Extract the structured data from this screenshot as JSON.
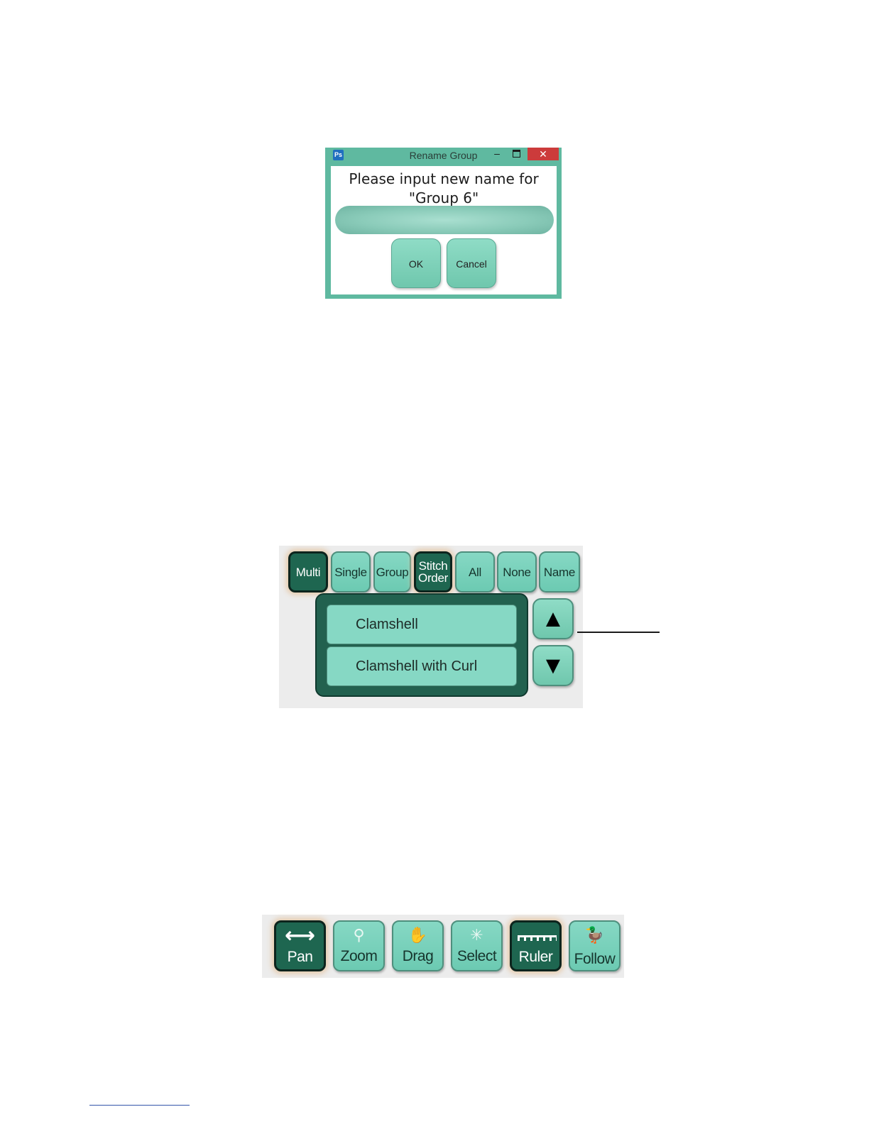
{
  "rename_dialog": {
    "title": "Rename Group",
    "app_icon": "Ps",
    "minimize_glyph": "–",
    "close_glyph": "✕",
    "prompt_line1": "Please input new name for",
    "prompt_line2": "\"Group 6\"",
    "input_value": "",
    "ok_label": "OK",
    "cancel_label": "Cancel"
  },
  "selection_panel": {
    "mode_buttons": [
      {
        "label": "Multi",
        "active": true
      },
      {
        "label": "Single",
        "active": false
      },
      {
        "label": "Group",
        "active": false
      },
      {
        "label": "Stitch Order",
        "active": true
      },
      {
        "label": "All",
        "active": false
      },
      {
        "label": "None",
        "active": false
      },
      {
        "label": "Name",
        "active": false
      }
    ],
    "list_items": [
      "Clamshell",
      "Clamshell with Curl"
    ],
    "up_glyph": "▲",
    "down_glyph": "▼"
  },
  "nav_toolbar": {
    "buttons": [
      {
        "label": "Pan",
        "icon": "double-arrow-icon",
        "glyph": "⟷",
        "active": true
      },
      {
        "label": "Zoom",
        "icon": "magnifier-icon",
        "glyph": "⚲",
        "active": false
      },
      {
        "label": "Drag",
        "icon": "drag-hand-icon",
        "glyph": "✋",
        "active": false
      },
      {
        "label": "Select",
        "icon": "sparkle-icon",
        "glyph": "✳",
        "active": false
      },
      {
        "label": "Ruler",
        "icon": "ruler-icon",
        "glyph": "",
        "active": true
      },
      {
        "label": "Follow",
        "icon": "ducks-icon",
        "glyph": "🦆",
        "active": false
      }
    ]
  },
  "colors": {
    "accent_light": "#86d8c4",
    "accent_dark": "#1e6650",
    "dialog_frame": "#5fb9a0",
    "close_red": "#cc3b3b"
  }
}
